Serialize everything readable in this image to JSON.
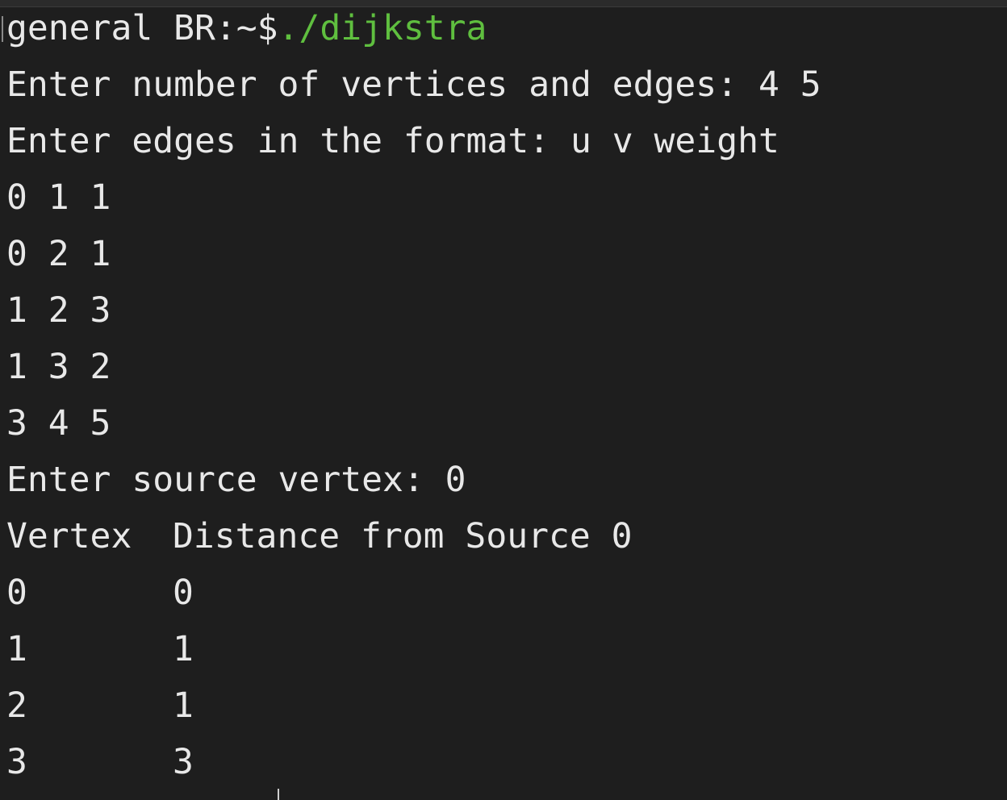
{
  "terminal": {
    "prompt": "general BR:~$",
    "command": "./dijkstra",
    "prompt_vertices": "Enter number of vertices and edges: 4 5",
    "prompt_edges": "Enter edges in the format: u v weight",
    "edges": [
      "0 1 1",
      "0 2 1",
      "1 2 3",
      "1 3 2",
      "3 4 5"
    ],
    "prompt_source": "Enter source vertex: 0",
    "table_header": {
      "vertex": "Vertex",
      "distance": "Distance from Source 0"
    },
    "results": [
      {
        "vertex": "0",
        "distance": "0"
      },
      {
        "vertex": "1",
        "distance": "1"
      },
      {
        "vertex": "2",
        "distance": "1"
      },
      {
        "vertex": "3",
        "distance": "3"
      }
    ]
  },
  "colors": {
    "background": "#1e1e1e",
    "text": "#e8e8e8",
    "command": "#5fbf3f"
  }
}
